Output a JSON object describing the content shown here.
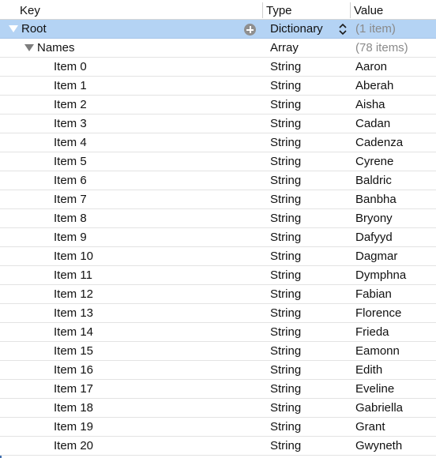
{
  "columns": {
    "key": "Key",
    "type": "Type",
    "value": "Value"
  },
  "root": {
    "key": "Root",
    "type": "Dictionary",
    "value": "(1 item)"
  },
  "names": {
    "key": "Names",
    "type": "Array",
    "value": "(78 items)"
  },
  "items": [
    {
      "key": "Item 0",
      "type": "String",
      "value": "Aaron"
    },
    {
      "key": "Item 1",
      "type": "String",
      "value": "Aberah"
    },
    {
      "key": "Item 2",
      "type": "String",
      "value": "Aisha"
    },
    {
      "key": "Item 3",
      "type": "String",
      "value": "Cadan"
    },
    {
      "key": "Item 4",
      "type": "String",
      "value": "Cadenza"
    },
    {
      "key": "Item 5",
      "type": "String",
      "value": "Cyrene"
    },
    {
      "key": "Item 6",
      "type": "String",
      "value": "Baldric"
    },
    {
      "key": "Item 7",
      "type": "String",
      "value": "Banbha"
    },
    {
      "key": "Item 8",
      "type": "String",
      "value": "Bryony"
    },
    {
      "key": "Item 9",
      "type": "String",
      "value": "Dafyyd"
    },
    {
      "key": "Item 10",
      "type": "String",
      "value": "Dagmar"
    },
    {
      "key": "Item 11",
      "type": "String",
      "value": "Dymphna"
    },
    {
      "key": "Item 12",
      "type": "String",
      "value": "Fabian"
    },
    {
      "key": "Item 13",
      "type": "String",
      "value": "Florence"
    },
    {
      "key": "Item 14",
      "type": "String",
      "value": "Frieda"
    },
    {
      "key": "Item 15",
      "type": "String",
      "value": "Eamonn"
    },
    {
      "key": "Item 16",
      "type": "String",
      "value": "Edith"
    },
    {
      "key": "Item 17",
      "type": "String",
      "value": "Eveline"
    },
    {
      "key": "Item 18",
      "type": "String",
      "value": "Gabriella"
    },
    {
      "key": "Item 19",
      "type": "String",
      "value": "Grant"
    },
    {
      "key": "Item 20",
      "type": "String",
      "value": "Gwyneth"
    }
  ],
  "colors": {
    "selection": "#b4d3f4",
    "muted_text": "#8a8a8a",
    "add_icon": "#8f8f8f",
    "row_divider": "#e3e3e3"
  },
  "icons": {
    "root_disclosure": "disclosure-triangle-expanded",
    "names_disclosure": "disclosure-triangle-expanded",
    "add": "plus-circle-icon",
    "type_stepper": "up-down-chevron-icon"
  }
}
